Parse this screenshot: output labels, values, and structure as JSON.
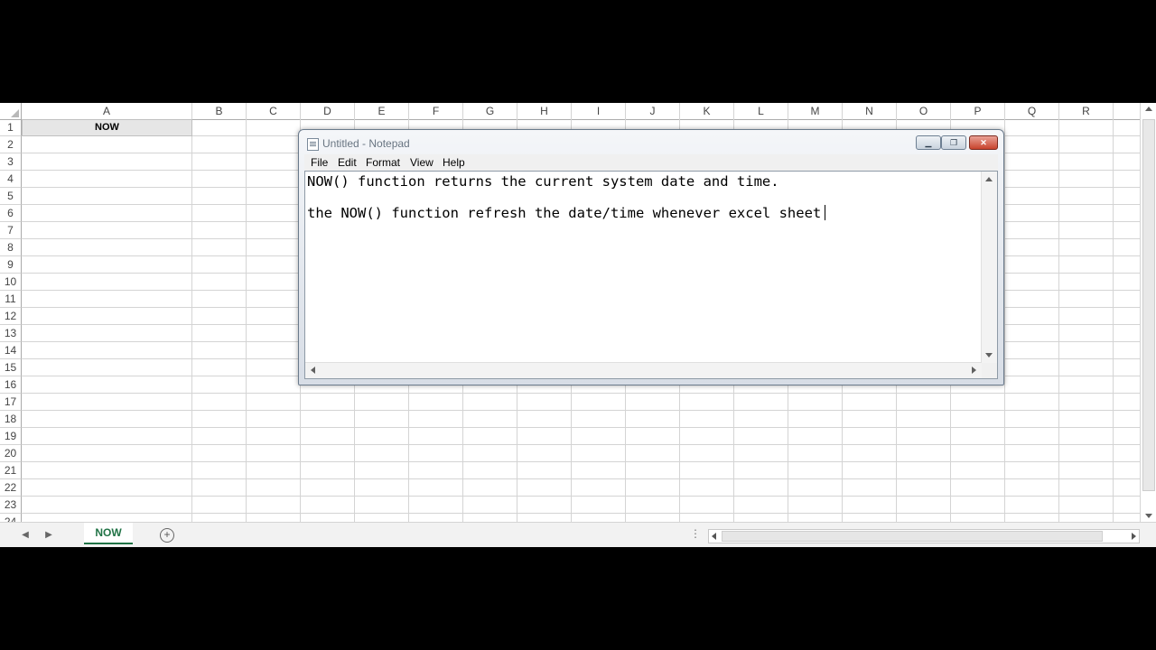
{
  "excel": {
    "columns": [
      "A",
      "B",
      "C",
      "D",
      "E",
      "F",
      "G",
      "H",
      "I",
      "J",
      "K",
      "L",
      "M",
      "N",
      "O",
      "P",
      "Q",
      "R"
    ],
    "rows": [
      "1",
      "2",
      "3",
      "4",
      "5",
      "6",
      "7",
      "8",
      "9",
      "10",
      "11",
      "12",
      "13",
      "14",
      "15",
      "16",
      "17",
      "18",
      "19",
      "20",
      "21",
      "22",
      "23",
      "24"
    ],
    "cell_a1": "NOW",
    "sheet_tab": "NOW",
    "colors": {
      "accent": "#217346",
      "selected_cell": "#e6e6e6"
    }
  },
  "notepad": {
    "title": "Untitled - Notepad",
    "menu": [
      {
        "label": "File"
      },
      {
        "label": "Edit"
      },
      {
        "label": "Format"
      },
      {
        "label": "View"
      },
      {
        "label": "Help"
      }
    ],
    "lines": [
      "NOW() function returns the current system date and time.",
      "the NOW() function refresh the date/time whenever excel sheet"
    ]
  }
}
